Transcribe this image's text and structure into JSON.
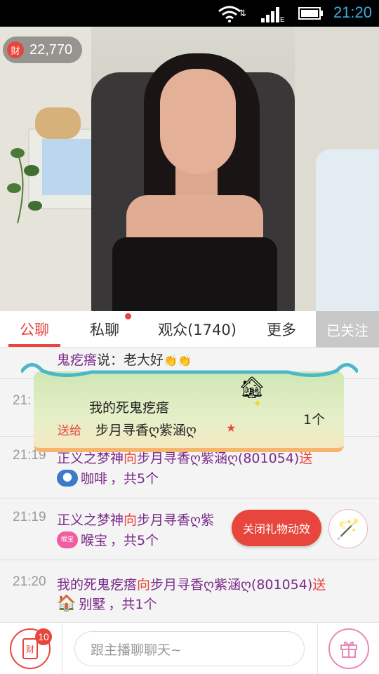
{
  "status_bar": {
    "time": "21:20"
  },
  "video": {
    "coin_icon_label": "财",
    "coin_count": "22,770"
  },
  "tabs": [
    {
      "label": "公聊",
      "active": true
    },
    {
      "label": "私聊",
      "has_dot": true
    },
    {
      "label": "观众(1740)"
    },
    {
      "label": "更多"
    }
  ],
  "follow_button": "已关注",
  "chat": [
    {
      "user": "鬼疙瘩",
      "text": "说：老大好",
      "emoji": "👏👏"
    },
    {
      "time": "21:",
      "line1_partial": ""
    },
    {
      "time": "21:19",
      "user": "正义之梦神",
      "verb": "向",
      "target": "步月寻香ღ紫涵ღ",
      "id": "(801054)",
      "tail": "送",
      "gift": "咖啡",
      "gift_count_text": "，共5个"
    },
    {
      "time": "21:19",
      "user": "正义之梦神",
      "verb": "向",
      "target": "步月寻香ღ紫",
      "id": "",
      "tail": "送",
      "gift": "喉宝",
      "gift_count_text": "，共5个",
      "gift_icon_label": "喉宝"
    },
    {
      "time": "21:20",
      "user": "我的死鬼疙瘩",
      "verb": "向",
      "target": "步月寻香ღ紫涵ღ",
      "id": "(801054)",
      "tail": "送",
      "gift": "别墅",
      "gift_count_text": "，共1个"
    }
  ],
  "gift_banner": {
    "sender": "我的死鬼疙瘩",
    "send_label": "送给",
    "receiver": "步月寻香ღ紫涵ღ",
    "count": "1个"
  },
  "close_effects_button": "关闭礼物动效",
  "bottom_bar": {
    "wallet_label": "财",
    "wallet_badge": "10",
    "input_placeholder": "跟主播聊聊天~"
  },
  "colors": {
    "accent": "#e8453c",
    "username": "#7a2a8a"
  }
}
